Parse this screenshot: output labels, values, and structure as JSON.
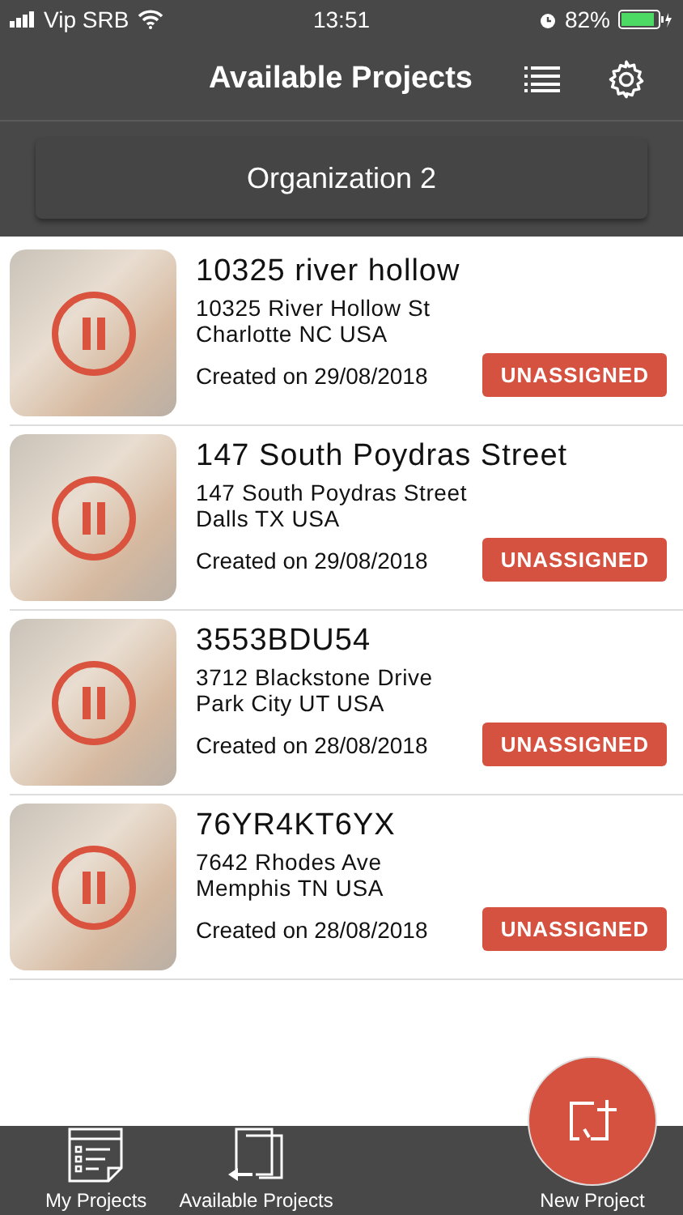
{
  "status_bar": {
    "carrier": "Vip SRB",
    "time": "13:51",
    "battery": "82%"
  },
  "nav": {
    "title": "Available Projects"
  },
  "organization": {
    "label": "Organization 2"
  },
  "projects": [
    {
      "name": "10325 river hollow",
      "street": "10325 River Hollow St",
      "city": "Charlotte NC USA",
      "created": "Created on 29/08/2018",
      "status": "UNASSIGNED"
    },
    {
      "name": "147 South Poydras Street",
      "street": "147 South Poydras Street",
      "city": "Dalls TX USA",
      "created": "Created on 29/08/2018",
      "status": "UNASSIGNED"
    },
    {
      "name": "3553BDU54",
      "street": "3712 Blackstone Drive",
      "city": "Park City UT USA",
      "created": "Created on 28/08/2018",
      "status": "UNASSIGNED"
    },
    {
      "name": "76YR4KT6YX",
      "street": "7642 Rhodes Ave",
      "city": "Memphis TN USA",
      "created": "Created on 28/08/2018",
      "status": "UNASSIGNED"
    }
  ],
  "tab_bar": [
    {
      "kind": "my",
      "label": "My Projects"
    },
    {
      "kind": "available",
      "label": "Available Projects"
    },
    {
      "kind": "new",
      "label": "New Project"
    }
  ]
}
